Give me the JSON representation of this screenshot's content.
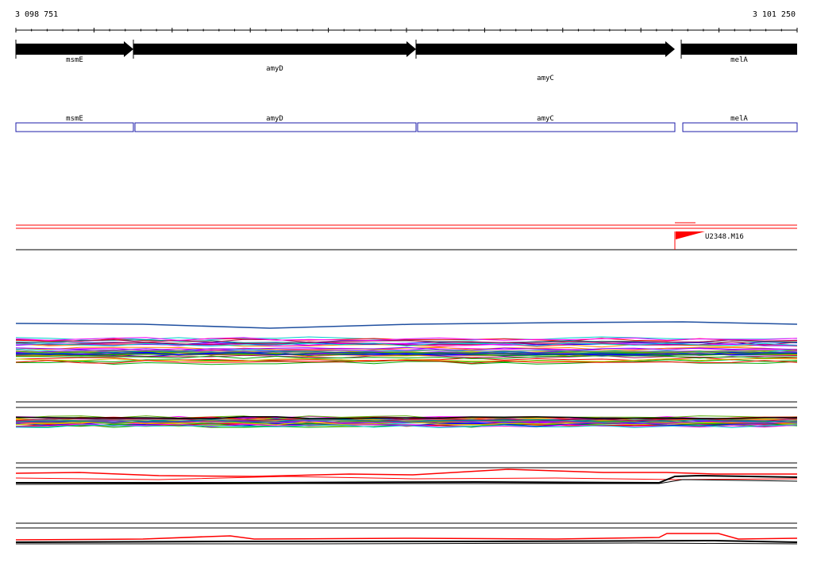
{
  "ruler": {
    "start_label": "3 098 751",
    "end_label": "3 101 250"
  },
  "genes": [
    {
      "name": "msmE",
      "start": 0,
      "end": 148,
      "label_offset": 0
    },
    {
      "name": "amyD",
      "start": 148,
      "end": 504,
      "label_offset": 1
    },
    {
      "name": "amyC",
      "start": 504,
      "end": 830,
      "label_offset": 2
    },
    {
      "name": "melA",
      "start": 838,
      "end": 984,
      "label_offset": 0
    }
  ],
  "feature_label": "U2348.M16",
  "colors": {
    "gene_arrow": "#000000",
    "gene_box": "#1c1ca8",
    "feature": "#ff0000",
    "track_line": "#000000",
    "axis_blue": "#1f4fa0"
  },
  "expression_palette": [
    "#ff0000",
    "#00aa00",
    "#0000ff",
    "#ff00ff",
    "#00cccc",
    "#cccc00",
    "#ff8800",
    "#8800ff",
    "#008888",
    "#888888",
    "#aa0055",
    "#55aa00"
  ]
}
